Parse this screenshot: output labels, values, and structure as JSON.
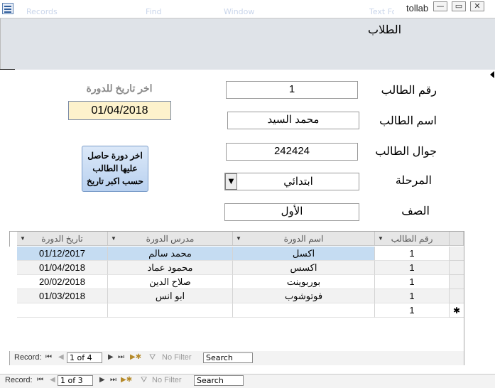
{
  "window": {
    "title": "tollab",
    "buttons": {
      "minimize": "—",
      "restore": "▭",
      "close": "✕"
    },
    "ghost_labels": [
      "Records",
      "Find",
      "Window",
      "Text Formatting"
    ]
  },
  "form": {
    "title": "الطلاب",
    "labels": {
      "student_no": "رقم الطالب",
      "student_name": "اسم الطالب",
      "student_mobile": "جوال الطالب",
      "stage": "المرحلة",
      "grade": "الصف",
      "last_course_date": "اخر تاريخ للدورة"
    },
    "values": {
      "student_no": "1",
      "student_name": "محمد السيد",
      "student_mobile": "242424",
      "stage": "ابتدائي",
      "grade": "الأول",
      "last_course_date": "01/04/2018"
    },
    "action_button_lines": [
      "اخر دورة حاصل",
      "عليها الطالب",
      "حسب اكبر تاريخ"
    ]
  },
  "subform": {
    "columns": [
      "رقم الطالب",
      "اسم الدورة",
      "مدرس الدورة",
      "تاريخ الدورة"
    ],
    "rows": [
      {
        "student_no": "1",
        "course": "اكسل",
        "teacher": "محمد سالم",
        "date": "01/12/2017"
      },
      {
        "student_no": "1",
        "course": "اكسس",
        "teacher": "محمود عماد",
        "date": "01/04/2018"
      },
      {
        "student_no": "1",
        "course": "بوربوينت",
        "teacher": "صلاح الدين",
        "date": "20/02/2018"
      },
      {
        "student_no": "1",
        "course": "فوتوشوب",
        "teacher": "ابو انس",
        "date": "01/03/2018"
      }
    ],
    "new_row": {
      "student_no": "1",
      "marker": "✱"
    },
    "nav": {
      "record_label": "Record:",
      "position": "1 of 4",
      "filter": "No Filter",
      "search": "Search"
    }
  },
  "main_nav": {
    "record_label": "Record:",
    "position": "1 of 3",
    "filter": "No Filter",
    "search": "Search"
  },
  "colors": {
    "header_bg": "#dfe3e8",
    "date_field_bg": "#fdf2cc",
    "selected_row": "#c5dcf2",
    "button_bg": "#c9dcf4"
  }
}
